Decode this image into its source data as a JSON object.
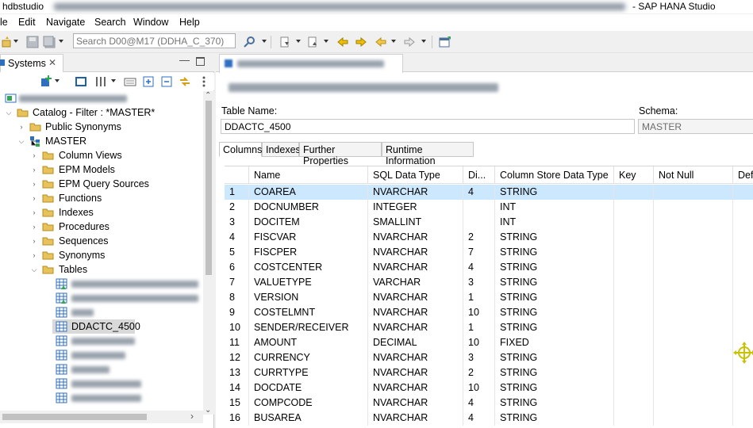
{
  "window": {
    "app_prefix": "hdbstudio",
    "app_suffix": "- SAP HANA Studio"
  },
  "menu": [
    "le",
    "Edit",
    "Navigate",
    "Search",
    "Window",
    "Help"
  ],
  "toolbar": {
    "search_placeholder": "Search D00@M17 (DDHA_C_370)"
  },
  "systems_view": {
    "tab_label": "Systems"
  },
  "tree": {
    "catalog_label": "Catalog - Filter : *MASTER*",
    "public_synonyms": "Public Synonyms",
    "schema": "MASTER",
    "folders": [
      "Column Views",
      "EPM Models",
      "EPM Query Sources",
      "Functions",
      "Indexes",
      "Procedures",
      "Sequences",
      "Synonyms"
    ],
    "tables_folder": "Tables",
    "selected_table": "DDACTC_4500"
  },
  "editor": {
    "table_name_label": "Table Name:",
    "table_name_value": "DDACTC_4500",
    "schema_label": "Schema:",
    "schema_value": "MASTER",
    "subtabs": [
      "Columns",
      "Indexes",
      "Further Properties",
      "Runtime Information"
    ]
  },
  "columns_grid": {
    "headers": [
      "",
      "Name",
      "SQL Data Type",
      "Di...",
      "Column Store Data Type",
      "Key",
      "Not Null",
      "Def"
    ],
    "rows": [
      {
        "num": "1",
        "name": "COAREA",
        "sql_type": "NVARCHAR",
        "dim": "4",
        "cs_type": "STRING"
      },
      {
        "num": "2",
        "name": "DOCNUMBER",
        "sql_type": "INTEGER",
        "dim": "",
        "cs_type": "INT"
      },
      {
        "num": "3",
        "name": "DOCITEM",
        "sql_type": "SMALLINT",
        "dim": "",
        "cs_type": "INT"
      },
      {
        "num": "4",
        "name": "FISCVAR",
        "sql_type": "NVARCHAR",
        "dim": "2",
        "cs_type": "STRING"
      },
      {
        "num": "5",
        "name": "FISCPER",
        "sql_type": "NVARCHAR",
        "dim": "7",
        "cs_type": "STRING"
      },
      {
        "num": "6",
        "name": "COSTCENTER",
        "sql_type": "NVARCHAR",
        "dim": "4",
        "cs_type": "STRING"
      },
      {
        "num": "7",
        "name": "VALUETYPE",
        "sql_type": "VARCHAR",
        "dim": "3",
        "cs_type": "STRING"
      },
      {
        "num": "8",
        "name": "VERSION",
        "sql_type": "NVARCHAR",
        "dim": "1",
        "cs_type": "STRING"
      },
      {
        "num": "9",
        "name": "COSTELMNT",
        "sql_type": "NVARCHAR",
        "dim": "10",
        "cs_type": "STRING"
      },
      {
        "num": "10",
        "name": "SENDER/RECEIVER",
        "sql_type": "NVARCHAR",
        "dim": "1",
        "cs_type": "STRING"
      },
      {
        "num": "11",
        "name": "AMOUNT",
        "sql_type": "DECIMAL",
        "dim": "10",
        "cs_type": "FIXED"
      },
      {
        "num": "12",
        "name": "CURRENCY",
        "sql_type": "NVARCHAR",
        "dim": "3",
        "cs_type": "STRING"
      },
      {
        "num": "13",
        "name": "CURRTYPE",
        "sql_type": "NVARCHAR",
        "dim": "2",
        "cs_type": "STRING"
      },
      {
        "num": "14",
        "name": "DOCDATE",
        "sql_type": "NVARCHAR",
        "dim": "10",
        "cs_type": "STRING"
      },
      {
        "num": "15",
        "name": "COMPCODE",
        "sql_type": "NVARCHAR",
        "dim": "4",
        "cs_type": "STRING"
      },
      {
        "num": "16",
        "name": "BUSAREA",
        "sql_type": "NVARCHAR",
        "dim": "4",
        "cs_type": "STRING"
      }
    ]
  },
  "colors": {
    "selection_blue": "#cce8ff",
    "tree_selection": "#d9d9d9",
    "folder_yellow": "#e8c25a",
    "table_blue": "#2f6fc0"
  }
}
